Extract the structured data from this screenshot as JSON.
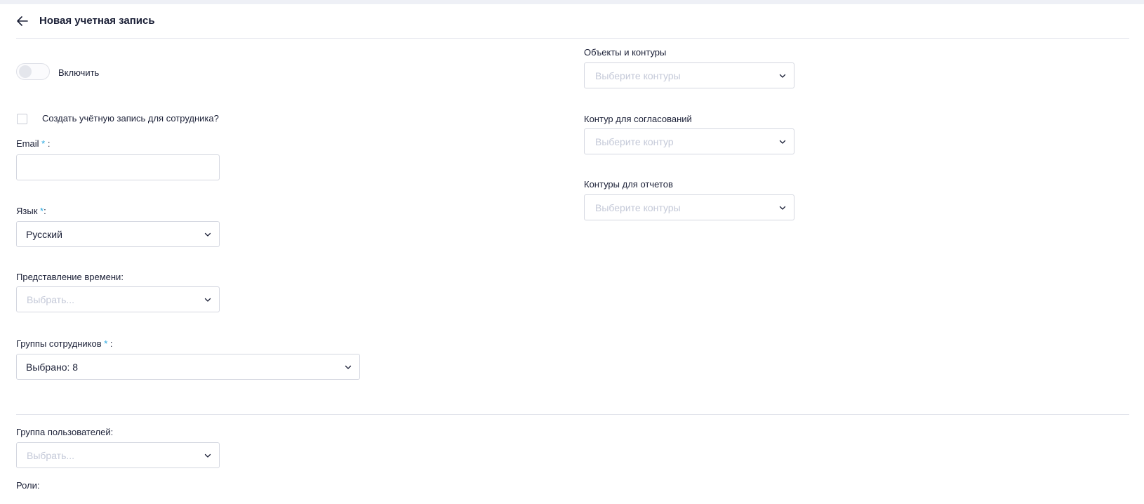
{
  "header": {
    "title": "Новая учетная запись"
  },
  "form": {
    "enable_toggle": {
      "label": "Включить",
      "on": false
    },
    "create_for_employee": {
      "label": "Создать учётную запись для сотрудника?",
      "checked": false
    },
    "email": {
      "label": "Email",
      "required_mark": "*",
      "suffix": " :",
      "value": ""
    },
    "language": {
      "label": "Язык",
      "required_mark": "*",
      "suffix": ":",
      "value": "Русский"
    },
    "time_format": {
      "label": "Представление времени:",
      "placeholder": "Выбрать..."
    },
    "employee_groups": {
      "label": "Группы сотрудников",
      "required_mark": "*",
      "suffix": " :",
      "value": "Выбрано: 8"
    },
    "user_group": {
      "label": "Группа пользователей:",
      "placeholder": "Выбрать..."
    },
    "roles_partial_label": "Роли:",
    "objects_contours": {
      "label": "Объекты и контуры",
      "placeholder": "Выберите контуры"
    },
    "approval_contour": {
      "label": "Контур для согласований",
      "placeholder": "Выберите контур"
    },
    "report_contours": {
      "label": "Контуры для отчетов",
      "placeholder": "Выберите контуры"
    }
  },
  "icons": {
    "back": "arrow-left-icon",
    "dropdown": "chevron-down-icon"
  },
  "colors": {
    "required": "#29a8e0",
    "placeholder": "#c4c9d8",
    "border": "#d4d7e0",
    "background": "#eef0f6"
  }
}
